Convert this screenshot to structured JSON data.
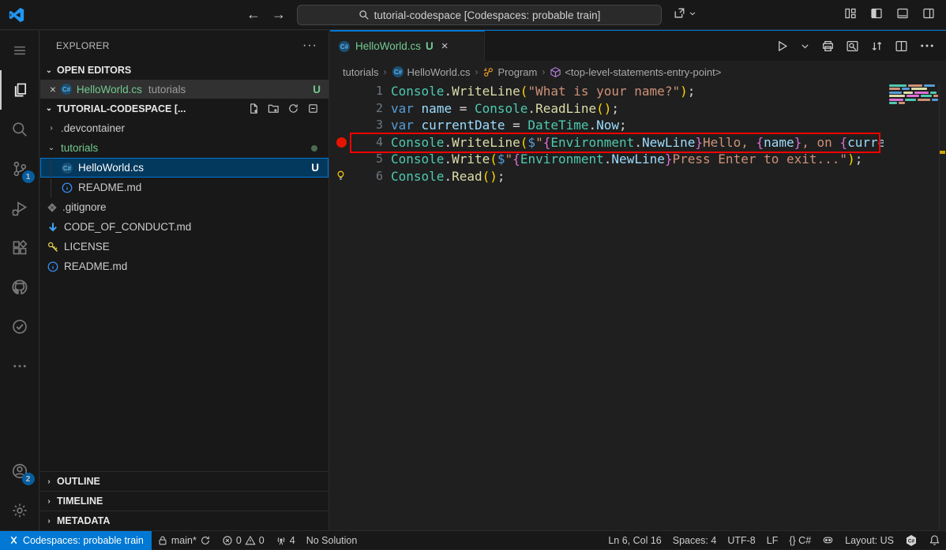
{
  "title_bar": {
    "search_placeholder": "tutorial-codespace [Codespaces: probable train]",
    "back_arrow": "←",
    "forward_arrow": "→",
    "layout_icons": [
      "customize-layout-icon",
      "toggle-primary-sidebar-icon",
      "toggle-panel-icon",
      "toggle-secondary-sidebar-icon"
    ]
  },
  "activity_bar": {
    "items": [
      {
        "name": "menu",
        "icon": "menu-icon",
        "active": false,
        "badge": null
      },
      {
        "name": "explorer",
        "icon": "files-icon",
        "active": true,
        "badge": null
      },
      {
        "name": "search",
        "icon": "search-icon",
        "active": false,
        "badge": null
      },
      {
        "name": "source-control",
        "icon": "source-control-icon",
        "active": false,
        "badge": "1"
      },
      {
        "name": "run-debug",
        "icon": "debug-icon",
        "active": false,
        "badge": null
      },
      {
        "name": "extensions",
        "icon": "extensions-icon",
        "active": false,
        "badge": null
      },
      {
        "name": "github",
        "icon": "github-icon",
        "active": false,
        "badge": null
      },
      {
        "name": "testing",
        "icon": "check-circle-icon",
        "active": false,
        "badge": null
      },
      {
        "name": "more",
        "icon": "ellipsis-icon",
        "active": false,
        "badge": null
      }
    ],
    "bottom_items": [
      {
        "name": "accounts",
        "icon": "account-icon",
        "active": false,
        "badge": "2"
      },
      {
        "name": "settings",
        "icon": "gear-icon",
        "active": false,
        "badge": null
      }
    ]
  },
  "explorer": {
    "title": "EXPLORER",
    "more_label": "···",
    "open_editors": {
      "header": "OPEN EDITORS",
      "items": [
        {
          "close": "×",
          "icon": "csharp-file-icon",
          "name": "HelloWorld.cs",
          "description": "tutorials",
          "badge": "U"
        }
      ]
    },
    "workspace": {
      "header": "TUTORIAL-CODESPACE [...",
      "actions": [
        "new-file-icon",
        "new-folder-icon",
        "refresh-icon",
        "collapse-all-icon"
      ]
    },
    "tree": [
      {
        "label": ".devcontainer",
        "chevron": "›",
        "indent": 0,
        "icon": null,
        "kind": "folder"
      },
      {
        "label": "tutorials",
        "chevron": "⌄",
        "indent": 0,
        "icon": null,
        "kind": "folder",
        "color": "#73c991",
        "dot_badge": true
      },
      {
        "label": "HelloWorld.cs",
        "indent": 1,
        "icon": "csharp-file-icon",
        "selected": true,
        "badge": "U"
      },
      {
        "label": "README.md",
        "indent": 1,
        "icon": "info-icon"
      },
      {
        "label": ".gitignore",
        "indent": 0,
        "icon": "gitignore-icon"
      },
      {
        "label": "CODE_OF_CONDUCT.md",
        "indent": 0,
        "icon": "markdown-down-icon"
      },
      {
        "label": "LICENSE",
        "indent": 0,
        "icon": "license-key-icon"
      },
      {
        "label": "README.md",
        "indent": 0,
        "icon": "info-icon"
      }
    ],
    "bottom_sections": [
      {
        "label": "OUTLINE"
      },
      {
        "label": "TIMELINE"
      },
      {
        "label": "METADATA"
      }
    ]
  },
  "editor": {
    "tab": {
      "icon": "csharp-file-icon",
      "label": "HelloWorld.cs",
      "badge": "U",
      "close": "×"
    },
    "actions": [
      "run-icon",
      "chevron-down-icon",
      "print-icon",
      "preview-search-icon",
      "compare-changes-icon",
      "split-editor-icon",
      "ellipsis-icon"
    ],
    "breadcrumbs": [
      {
        "label": "tutorials",
        "icon": null
      },
      {
        "label": "HelloWorld.cs",
        "icon": "csharp-file-icon"
      },
      {
        "label": "Program",
        "icon": "symbol-class-icon"
      },
      {
        "label": "<top-level-statements-entry-point>",
        "icon": "symbol-cube-icon"
      }
    ],
    "token_colors": {
      "t": "#4EC9B0",
      "m": "#DCDCAA",
      "k": "#569CD6",
      "v": "#9CDCFE",
      "s": "#CE9178",
      "p": "#d4d4d4",
      "b1": "#FFD700",
      "b2": "#DA70D6"
    },
    "code_lines": [
      {
        "n": "1",
        "gutter": null,
        "tokens": [
          [
            "t",
            "Console"
          ],
          [
            "p",
            "."
          ],
          [
            "m",
            "WriteLine"
          ],
          [
            "b1",
            "("
          ],
          [
            "s",
            "\"What is your name?\""
          ],
          [
            "b1",
            ")"
          ],
          [
            "p",
            ";"
          ]
        ]
      },
      {
        "n": "2",
        "gutter": null,
        "tokens": [
          [
            "k",
            "var"
          ],
          [
            "p",
            " "
          ],
          [
            "v",
            "name"
          ],
          [
            "p",
            " = "
          ],
          [
            "t",
            "Console"
          ],
          [
            "p",
            "."
          ],
          [
            "m",
            "ReadLine"
          ],
          [
            "b1",
            "()"
          ],
          [
            "p",
            ";"
          ]
        ]
      },
      {
        "n": "3",
        "gutter": null,
        "tokens": [
          [
            "k",
            "var"
          ],
          [
            "p",
            " "
          ],
          [
            "v",
            "currentDate"
          ],
          [
            "p",
            " = "
          ],
          [
            "t",
            "DateTime"
          ],
          [
            "p",
            "."
          ],
          [
            "v",
            "Now"
          ],
          [
            "p",
            ";"
          ]
        ]
      },
      {
        "n": "4",
        "gutter": "breakpoint",
        "tokens": [
          [
            "t",
            "Console"
          ],
          [
            "p",
            "."
          ],
          [
            "m",
            "WriteLine"
          ],
          [
            "b1",
            "("
          ],
          [
            "k",
            "$"
          ],
          [
            "s",
            "\""
          ],
          [
            "b2",
            "{"
          ],
          [
            "t",
            "Environment"
          ],
          [
            "p",
            "."
          ],
          [
            "v",
            "NewLine"
          ],
          [
            "b2",
            "}"
          ],
          [
            "s",
            "Hello, "
          ],
          [
            "b2",
            "{"
          ],
          [
            "v",
            "name"
          ],
          [
            "b2",
            "}"
          ],
          [
            "s",
            ", on "
          ],
          [
            "b2",
            "{"
          ],
          [
            "v",
            "currentDate"
          ]
        ]
      },
      {
        "n": "5",
        "gutter": null,
        "tokens": [
          [
            "t",
            "Console"
          ],
          [
            "p",
            "."
          ],
          [
            "m",
            "Write"
          ],
          [
            "b1",
            "("
          ],
          [
            "k",
            "$"
          ],
          [
            "s",
            "\""
          ],
          [
            "b2",
            "{"
          ],
          [
            "t",
            "Environment"
          ],
          [
            "p",
            "."
          ],
          [
            "v",
            "NewLine"
          ],
          [
            "b2",
            "}"
          ],
          [
            "s",
            "Press Enter to exit...\""
          ],
          [
            "b1",
            ")"
          ],
          [
            "p",
            ";"
          ]
        ]
      },
      {
        "n": "6",
        "gutter": "lightbulb",
        "tokens": [
          [
            "t",
            "Console"
          ],
          [
            "p",
            "."
          ],
          [
            "m",
            "Read"
          ],
          [
            "b1",
            "()"
          ],
          [
            "p",
            ";"
          ]
        ]
      }
    ],
    "minimap_rows": [
      [
        22,
        18,
        14
      ],
      [
        14,
        10,
        20
      ],
      [
        16,
        12,
        18,
        8
      ],
      [
        20,
        16,
        14,
        6
      ],
      [
        18,
        14,
        16,
        8
      ],
      [
        10,
        8
      ]
    ],
    "annotation_color": "#f50000",
    "overview_mark_color": "#cca700"
  },
  "status_bar": {
    "left": [
      {
        "name": "remote-indicator",
        "icon": "remote-icon",
        "label": "Codespaces: probable train",
        "accent": true
      },
      {
        "name": "branch",
        "icon": "lock-icon",
        "label": "main*",
        "icon_after": "sync-icon"
      },
      {
        "name": "problems",
        "parts": [
          {
            "icon": "error-icon",
            "label": "0"
          },
          {
            "icon": "warning-icon",
            "label": "0"
          }
        ]
      },
      {
        "name": "ports",
        "icon": "radio-tower-icon",
        "label": "4"
      },
      {
        "name": "solution",
        "icon": null,
        "label": "No Solution"
      }
    ],
    "right": [
      {
        "name": "cursor-position",
        "label": "Ln 6, Col 16"
      },
      {
        "name": "indentation",
        "label": "Spaces: 4"
      },
      {
        "name": "encoding",
        "label": "UTF-8"
      },
      {
        "name": "eol",
        "label": "LF"
      },
      {
        "name": "language-mode",
        "label": "{} C#"
      },
      {
        "name": "copilot",
        "icon": "copilot-icon",
        "label": ""
      },
      {
        "name": "keyboard-layout",
        "label": "Layout: US"
      },
      {
        "name": "csharp-status",
        "icon": "csharp-hex-icon",
        "label": ""
      },
      {
        "name": "notifications",
        "icon": "bell-icon",
        "label": ""
      }
    ]
  },
  "colors": {
    "accent": "#0078d4",
    "untracked_green": "#73c991",
    "breakpoint_red": "#e51400",
    "sidebar_bg": "#181818",
    "editor_bg": "#1f1f1f"
  }
}
